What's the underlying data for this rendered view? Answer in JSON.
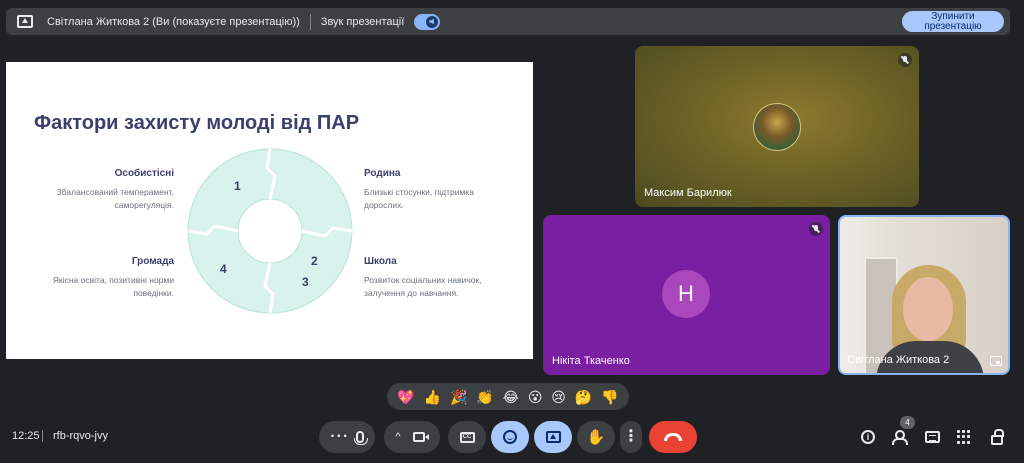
{
  "presenting_bar": {
    "presenter_text": "Світлана Житкова 2 (Ви (показуєте презентацію))",
    "sound_label": "Звук презентації",
    "stop_button_line1": "Зупинити",
    "stop_button_line2": "презентацію"
  },
  "slide": {
    "title": "Фактори захисту молоді від ПАР",
    "factors": [
      {
        "num": "1",
        "heading": "Особистісні",
        "text_line1": "Збалансований темперамент,",
        "text_line2": "саморегуляція."
      },
      {
        "num": "2",
        "heading": "Родина",
        "text_line1": "Близькі стосунки, підтримка",
        "text_line2": "дорослих."
      },
      {
        "num": "3",
        "heading": "Школа",
        "text_line1": "Розвиток соціальних навичок,",
        "text_line2": "залучення до навчання."
      },
      {
        "num": "4",
        "heading": "Громада",
        "text_line1": "Якісна освіта, позитивні норми",
        "text_line2": "поведінки."
      }
    ],
    "ring_color": "#daf2ec",
    "title_color": "#3a3f6b"
  },
  "participants": [
    {
      "name": "Максим Барилюк",
      "muted": true,
      "avatar": "photo"
    },
    {
      "name": "Нікіта Ткаченко",
      "muted": true,
      "avatar_letter": "H"
    },
    {
      "name": "Світлана Житкова 2",
      "muted": false,
      "avatar": "video"
    }
  ],
  "reactions": [
    "💖",
    "👍",
    "🎉",
    "👏",
    "😂",
    "😮",
    "😢",
    "🤔",
    "👎"
  ],
  "bottom_bar": {
    "time": "12:25",
    "meeting_code": "rfb-rqvo-jvy",
    "people_count": "4"
  },
  "colors": {
    "background": "#202124",
    "accent": "#a8c7fa",
    "end_call": "#ea4335",
    "tile_purple": "#7b1fa2"
  }
}
